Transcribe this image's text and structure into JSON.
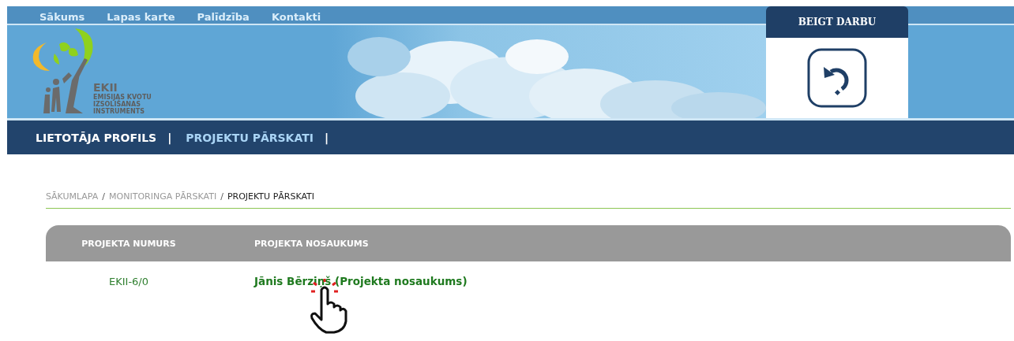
{
  "top_links": [
    "Sākums",
    "Lapas karte",
    "Palīdzība",
    "Kontakti"
  ],
  "logo": {
    "title": "EKII",
    "subtitle_lines": [
      "EMISIJAS KVOTU",
      "IZSOLIŠANAS",
      "INSTRUMENTS"
    ]
  },
  "end_panel": {
    "title": "BEIGT DARBU"
  },
  "nav": [
    {
      "label": "LIETOTĀJA PROFILS",
      "selected": false
    },
    {
      "label": "PROJEKTU PĀRSKATI",
      "selected": true
    }
  ],
  "nav_separator": "|",
  "breadcrumb": [
    {
      "label": "SĀKUMLAPA",
      "current": false
    },
    {
      "label": "MONITORINGA PĀRSKATI",
      "current": false
    },
    {
      "label": "PROJEKTU PĀRSKATI",
      "current": true
    }
  ],
  "breadcrumb_separator": "/",
  "table": {
    "columns": [
      "PROJEKTA NUMURS",
      "PROJEKTA NOSAUKUMS"
    ],
    "rows": [
      {
        "number": "EKII-6/0",
        "name": "Jānis Bērziņš (Projekta nosaukums)"
      }
    ]
  }
}
